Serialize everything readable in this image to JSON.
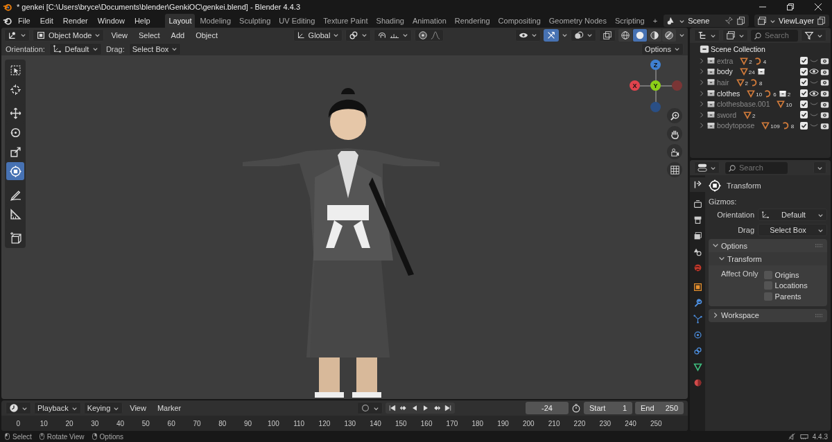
{
  "window": {
    "title": "* genkei [C:\\Users\\bryce\\Documents\\blender\\GenkiOC\\genkei.blend] - Blender 4.4.3"
  },
  "menu": [
    "File",
    "Edit",
    "Render",
    "Window",
    "Help"
  ],
  "workspaces": [
    {
      "label": "Layout",
      "selected": true
    },
    {
      "label": "Modeling",
      "selected": false
    },
    {
      "label": "Sculpting",
      "selected": false
    },
    {
      "label": "UV Editing",
      "selected": false
    },
    {
      "label": "Texture Paint",
      "selected": false
    },
    {
      "label": "Shading",
      "selected": false
    },
    {
      "label": "Animation",
      "selected": false
    },
    {
      "label": "Rendering",
      "selected": false
    },
    {
      "label": "Compositing",
      "selected": false
    },
    {
      "label": "Geometry Nodes",
      "selected": false
    },
    {
      "label": "Scripting",
      "selected": false
    }
  ],
  "add_workspace": "+",
  "scene": {
    "name": "Scene"
  },
  "view_layer": {
    "name": "ViewLayer"
  },
  "viewport": {
    "mode": "Object Mode",
    "menus": [
      "View",
      "Select",
      "Add",
      "Object"
    ],
    "orientation": "Global",
    "proportional_edit": false,
    "gizmos_on": true,
    "overlays_on": false,
    "shading": [
      {
        "kind": "wireframe",
        "selected": false
      },
      {
        "kind": "solid",
        "selected": true
      },
      {
        "kind": "material",
        "selected": false
      },
      {
        "kind": "rendered",
        "selected": false
      }
    ],
    "tool_settings": {
      "orientation_label": "Orientation:",
      "orientation": "Default",
      "drag_label": "Drag:",
      "drag": "Select Box",
      "options": "Options"
    },
    "tools": [
      {
        "kind": "select",
        "selected": false
      },
      {
        "kind": "cursor",
        "selected": false
      },
      {
        "kind": "move",
        "selected": false
      },
      {
        "kind": "rotate",
        "selected": false
      },
      {
        "kind": "scale",
        "selected": false
      },
      {
        "kind": "transform",
        "selected": true
      },
      {
        "kind": "annotate",
        "selected": false
      },
      {
        "kind": "measure",
        "selected": false
      },
      {
        "kind": "add_cube",
        "selected": false
      }
    ],
    "axes": [
      "X",
      "Y",
      "Z"
    ]
  },
  "outliner": {
    "search_placeholder": "Search",
    "root": "Scene Collection",
    "collections": [
      {
        "name": "extra",
        "visible": false,
        "included": true,
        "contents": [
          {
            "kind": "mesh",
            "count": "2"
          },
          {
            "kind": "armature",
            "count": "4"
          }
        ]
      },
      {
        "name": "body",
        "visible": true,
        "included": true,
        "contents": [
          {
            "kind": "mesh",
            "count": "24"
          },
          {
            "kind": "collection"
          }
        ]
      },
      {
        "name": "hair",
        "visible": false,
        "included": true,
        "contents": [
          {
            "kind": "mesh",
            "count": "2"
          },
          {
            "kind": "armature",
            "count": "8"
          }
        ]
      },
      {
        "name": "clothes",
        "visible": true,
        "included": true,
        "contents": [
          {
            "kind": "mesh",
            "count": "10"
          },
          {
            "kind": "armature",
            "count": "6"
          },
          {
            "kind": "collection",
            "count": "2"
          }
        ]
      },
      {
        "name": "clothesbase.001",
        "visible": false,
        "included": true,
        "contents": [
          {
            "kind": "mesh",
            "count": "10"
          }
        ]
      },
      {
        "name": "sword",
        "visible": false,
        "included": true,
        "contents": [
          {
            "kind": "mesh",
            "count": "2"
          }
        ]
      },
      {
        "name": "bodytopose",
        "visible": false,
        "included": true,
        "contents": [
          {
            "kind": "mesh",
            "count": "109"
          },
          {
            "kind": "armature",
            "count": "8"
          }
        ]
      }
    ]
  },
  "properties": {
    "search_placeholder": "Search",
    "tabs": [
      {
        "kind": "tool",
        "selected": true
      },
      {
        "kind": "render",
        "selected": false
      },
      {
        "kind": "output",
        "selected": false
      },
      {
        "kind": "view_layer",
        "selected": false
      },
      {
        "kind": "scene",
        "selected": false
      },
      {
        "kind": "world",
        "selected": false
      },
      {
        "kind": "object",
        "selected": false
      },
      {
        "kind": "modifiers",
        "selected": false
      },
      {
        "kind": "particles",
        "selected": false
      },
      {
        "kind": "physics",
        "selected": false
      },
      {
        "kind": "constraints",
        "selected": false
      },
      {
        "kind": "data",
        "selected": false
      },
      {
        "kind": "material",
        "selected": false
      }
    ],
    "tool_name": "Transform",
    "gizmos_label": "Gizmos:",
    "orientation_label": "Orientation",
    "orientation": "Default",
    "drag_label": "Drag",
    "drag": "Select Box",
    "panels": [
      {
        "title": "Options",
        "expanded": true,
        "subpanel": {
          "title": "Transform",
          "expanded": true
        },
        "affect_label": "Affect Only",
        "checkboxes": [
          {
            "label": "Origins",
            "checked": false
          },
          {
            "label": "Locations",
            "checked": false
          },
          {
            "label": "Parents",
            "checked": false
          }
        ]
      },
      {
        "title": "Workspace",
        "expanded": false
      }
    ]
  },
  "timeline": {
    "auto_key": false,
    "menus": [
      "Playback",
      "Keying",
      "View",
      "Marker"
    ],
    "current_frame": "-24",
    "start_label": "Start",
    "start": "1",
    "end_label": "End",
    "end": "250",
    "ticks": [
      "0",
      "10",
      "20",
      "30",
      "40",
      "50",
      "60",
      "70",
      "80",
      "90",
      "100",
      "110",
      "120",
      "130",
      "140",
      "150",
      "160",
      "170",
      "180",
      "190",
      "200",
      "210",
      "220",
      "230",
      "240",
      "250"
    ]
  },
  "status_bar": {
    "hints": [
      "Select",
      "Rotate View",
      "Options"
    ],
    "version": "4.4.3"
  }
}
